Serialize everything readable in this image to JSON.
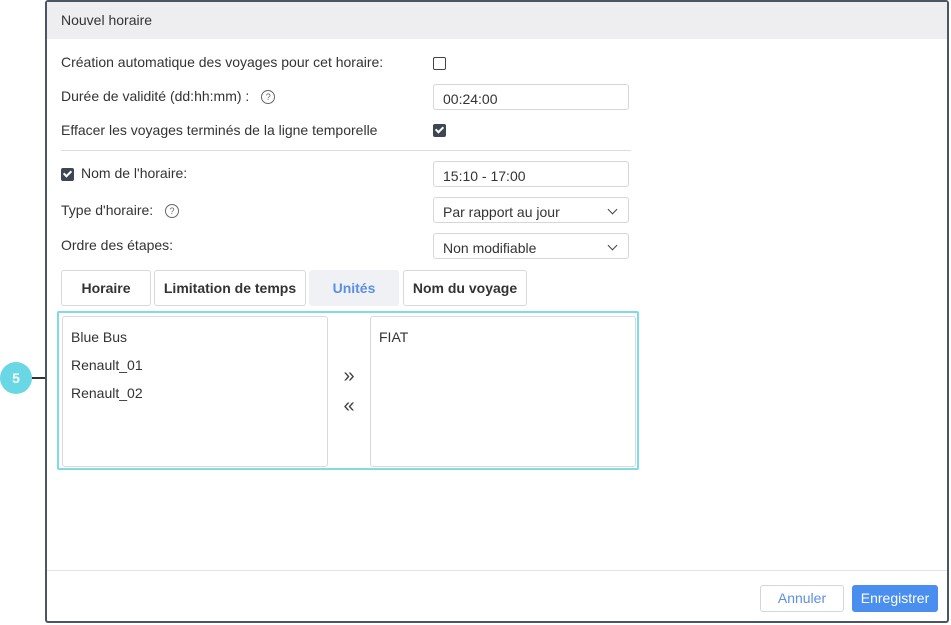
{
  "dialog": {
    "title": "Nouvel horaire"
  },
  "form": {
    "auto_create_label": "Création automatique des voyages pour cet horaire:",
    "auto_create_checked": false,
    "validity_label": "Durée de validité (dd:hh:mm)  :",
    "validity_value": "00:24:00",
    "clear_label": "Effacer les voyages terminés de la ligne temporelle",
    "clear_checked": true,
    "name_label": "Nom de l'horaire:",
    "name_checked": true,
    "name_value": "15:10 - 17:00",
    "type_label": "Type d'horaire:",
    "type_value": "Par rapport au jour",
    "order_label": "Ordre des étapes:",
    "order_value": "Non modifiable",
    "help_icon": "?"
  },
  "tabs": [
    {
      "label": "Horaire",
      "active": false
    },
    {
      "label": "Limitation de temps",
      "active": false
    },
    {
      "label": "Unités",
      "active": true
    },
    {
      "label": "Nom du voyage",
      "active": false
    }
  ],
  "units": {
    "available": [
      "Blue Bus",
      "Renault_01",
      "Renault_02"
    ],
    "selected": [
      "FIAT"
    ],
    "move_right_icon": "»",
    "move_left_icon": "«"
  },
  "footer": {
    "cancel_label": "Annuler",
    "save_label": "Enregistrer"
  },
  "callout": {
    "number": "5"
  },
  "colors": {
    "accent": "#4a8ef0",
    "highlight": "#7fdbe5",
    "active_tab_text": "#5a8fe6"
  }
}
